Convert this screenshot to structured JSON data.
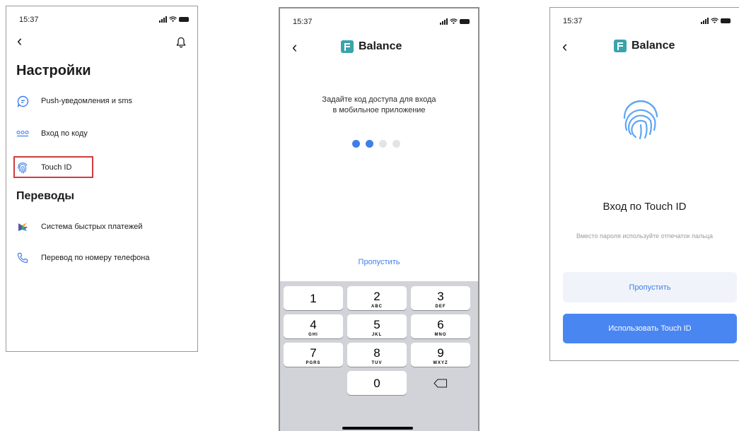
{
  "phone1": {
    "time": "15:37",
    "title": "Настройки",
    "items": [
      {
        "label": "Push-уведомления и sms",
        "icon": "chat-bubble-icon"
      },
      {
        "label": "Вход по коду",
        "icon": "passcode-icon"
      },
      {
        "label": "Touch ID",
        "icon": "fingerprint-icon"
      }
    ],
    "section2_title": "Переводы",
    "items2": [
      {
        "label": "Система быстрых платежей",
        "icon": "sbp-logo-icon"
      },
      {
        "label": "Перевод по номеру телефона",
        "icon": "phone-icon"
      }
    ],
    "highlight_color": "#d23a3f"
  },
  "phone2": {
    "time": "15:37",
    "brand": "Balance",
    "prompt_line1": "Задайте код доступа для входа",
    "prompt_line2": "в мобильное приложение",
    "pin_filled": 2,
    "pin_total": 4,
    "skip": "Пропустить",
    "keys": [
      {
        "num": "1",
        "sub": ""
      },
      {
        "num": "2",
        "sub": "ABC"
      },
      {
        "num": "3",
        "sub": "DEF"
      },
      {
        "num": "4",
        "sub": "GHI"
      },
      {
        "num": "5",
        "sub": "JKL"
      },
      {
        "num": "6",
        "sub": "MNO"
      },
      {
        "num": "7",
        "sub": "PGRS"
      },
      {
        "num": "8",
        "sub": "TUV"
      },
      {
        "num": "9",
        "sub": "WXYZ"
      },
      {
        "num": "0",
        "sub": ""
      }
    ]
  },
  "phone3": {
    "time": "15:37",
    "brand": "Balance",
    "title": "Вход по Touch ID",
    "description": "Вместо пароля используйте отпечаток пальца",
    "skip_button": "Пропустить",
    "use_button": "Использовать Touch ID"
  },
  "colors": {
    "accent": "#3f7fe9",
    "brand_logo": "#3aa3ab",
    "primary_button": "#4a86f2",
    "keypad_bg": "#d1d3d9"
  }
}
